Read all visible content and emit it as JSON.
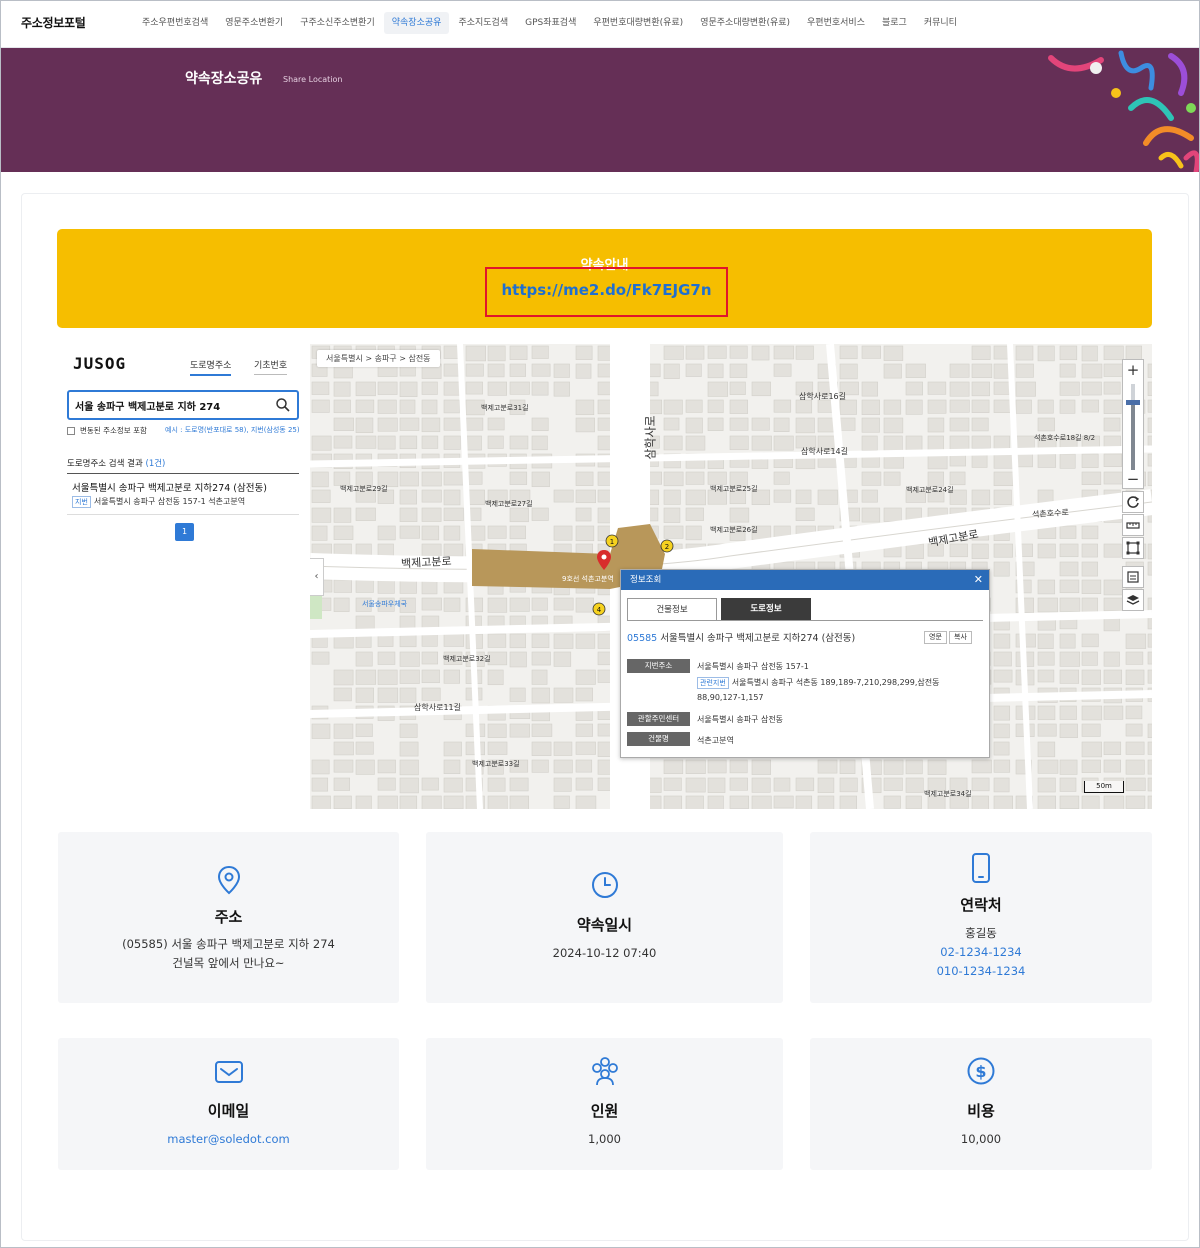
{
  "nav": {
    "brand": "주소정보포털",
    "items": [
      {
        "label": "주소우편번호검색",
        "active": false
      },
      {
        "label": "영문주소변환기",
        "active": false
      },
      {
        "label": "구주소신주소변환기",
        "active": false
      },
      {
        "label": "약속장소공유",
        "active": true
      },
      {
        "label": "주소지도검색",
        "active": false
      },
      {
        "label": "GPS좌표검색",
        "active": false
      },
      {
        "label": "우편번호대량변환(유료)",
        "active": false
      },
      {
        "label": "영문주소대량변환(유료)",
        "active": false
      },
      {
        "label": "우편번호서비스",
        "active": false
      },
      {
        "label": "블로그",
        "active": false
      },
      {
        "label": "커뮤니티",
        "active": false
      }
    ]
  },
  "banner": {
    "title": "약속장소공유",
    "subtitle": "Share Location"
  },
  "promise": {
    "title": "약속안내",
    "link": "https://me2.do/Fk7EJG7n"
  },
  "search": {
    "logo": "JUSOG",
    "tab_road": "도로명주소",
    "tab_base": "기초번호",
    "query": "서울 송파구 백제고분로 지하 274",
    "include_changed": "변동된 주소정보 포함",
    "example": "예시 : 도로명(반포대로 58), 지번(삼성동 25)",
    "result_head": "도로명주소 검색 결과",
    "result_count": "(1건)",
    "result": {
      "road": "서울특별시 송파구 백제고분로 지하274 (삼전동)",
      "jibun_tag": "지번",
      "jibun": "서울특별시 송파구 삼전동 157-1 석촌고분역"
    },
    "page": "1"
  },
  "map": {
    "breadcrumb": "서울특별시 > 송파구 > 삼전동",
    "road_labels": [
      "백제고분로",
      "백제고분로",
      "삼학사로",
      "석촌호수로",
      "삼학사로11길",
      "삼학사로16길",
      "삼학사로14길",
      "백제고분로32길",
      "백제고분로31길",
      "백제고분로33길",
      "백제고분로34길",
      "백제고분로29길",
      "백제고분로27길",
      "백제고분로25길",
      "백제고분로24길",
      "백제고분로26길",
      "석촌호수로18길 8/2"
    ],
    "station_label": "9호선 석촌고분역",
    "post_office": "서울송파우체국",
    "scale": "50m",
    "popup": {
      "title": "정보조회",
      "tab_building": "건물정보",
      "tab_road": "도로정보",
      "zip": "05585",
      "address": "서울특별시 송파구 백제고분로 지하274 (삼전동)",
      "btn_en": "영문",
      "btn_copy": "복사",
      "jibun_label": "지번주소",
      "jibun_value": "서울특별시 송파구 삼전동 157-1",
      "related_tag": "관련지번",
      "related_value": "서울특별시 송파구 석촌동 189,189-7,210,298,299,삼전동",
      "related_value2": "88,90,127-1,157",
      "center_label": "관할주민센터",
      "center_value": "서울특별시 송파구 삼전동",
      "building_label": "건물명",
      "building_value": "석촌고분역"
    }
  },
  "tiles": {
    "address": {
      "title": "주소",
      "line1": "(05585) 서울 송파구 백제고분로 지하 274",
      "line2": "건널목 앞에서 만나요~",
      "icon": "location-pin-icon"
    },
    "datetime": {
      "title": "약속일시",
      "value": "2024-10-12 07:40",
      "icon": "clock-icon"
    },
    "contact": {
      "title": "연락처",
      "name": "홍길동",
      "phone1": "02-1234-1234",
      "phone2": "010-1234-1234",
      "icon": "phone-icon"
    },
    "email": {
      "title": "이메일",
      "value": "master@soledot.com",
      "icon": "mail-icon"
    },
    "people": {
      "title": "인원",
      "value": "1,000",
      "icon": "people-icon"
    },
    "cost": {
      "title": "비용",
      "value": "10,000",
      "icon": "dollar-icon"
    }
  },
  "colors": {
    "accent": "#2f7ad6",
    "banner": "#652f56",
    "promise": "#f6be00",
    "highlight": "#e0142c"
  }
}
